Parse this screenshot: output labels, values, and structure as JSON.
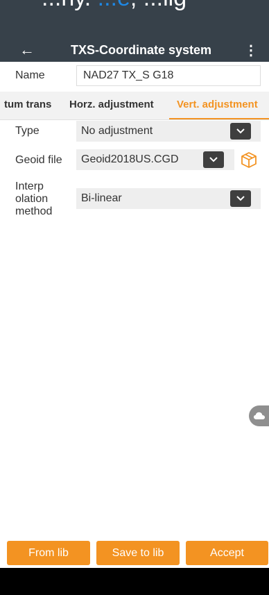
{
  "status_bar": {
    "text_plain": "...ny.",
    "text_highlight": "...e",
    "text_tail": "; ...lig"
  },
  "app_bar": {
    "back_icon": "arrow-left-icon",
    "title": "TXS-Coordinate system",
    "menu_icon": "more-vert-icon"
  },
  "name_row": {
    "label": "Name",
    "value": "NAD27 TX_S G18"
  },
  "tabs": [
    {
      "label": "tum trans",
      "active": false
    },
    {
      "label": "Horz. adjustment",
      "active": false
    },
    {
      "label": "Vert. adjustment",
      "active": true
    }
  ],
  "type_row": {
    "label": "Type",
    "value": "No adjustment"
  },
  "geoid_row": {
    "label": "Geoid file",
    "value": "Geoid2018US.CGD",
    "box_icon": "package-icon"
  },
  "interp_row": {
    "label_line1": "Interp",
    "label_line2": "olation",
    "label_line3": "method",
    "value": "Bi-linear"
  },
  "fab": {
    "icon": "cloud-icon"
  },
  "buttons": {
    "from_lib": "From lib",
    "save_to_lib": "Save to lib",
    "accept": "Accept"
  },
  "colors": {
    "accent": "#f39322",
    "appbar": "#37414a",
    "dropdown_button": "#3f3f3f"
  }
}
